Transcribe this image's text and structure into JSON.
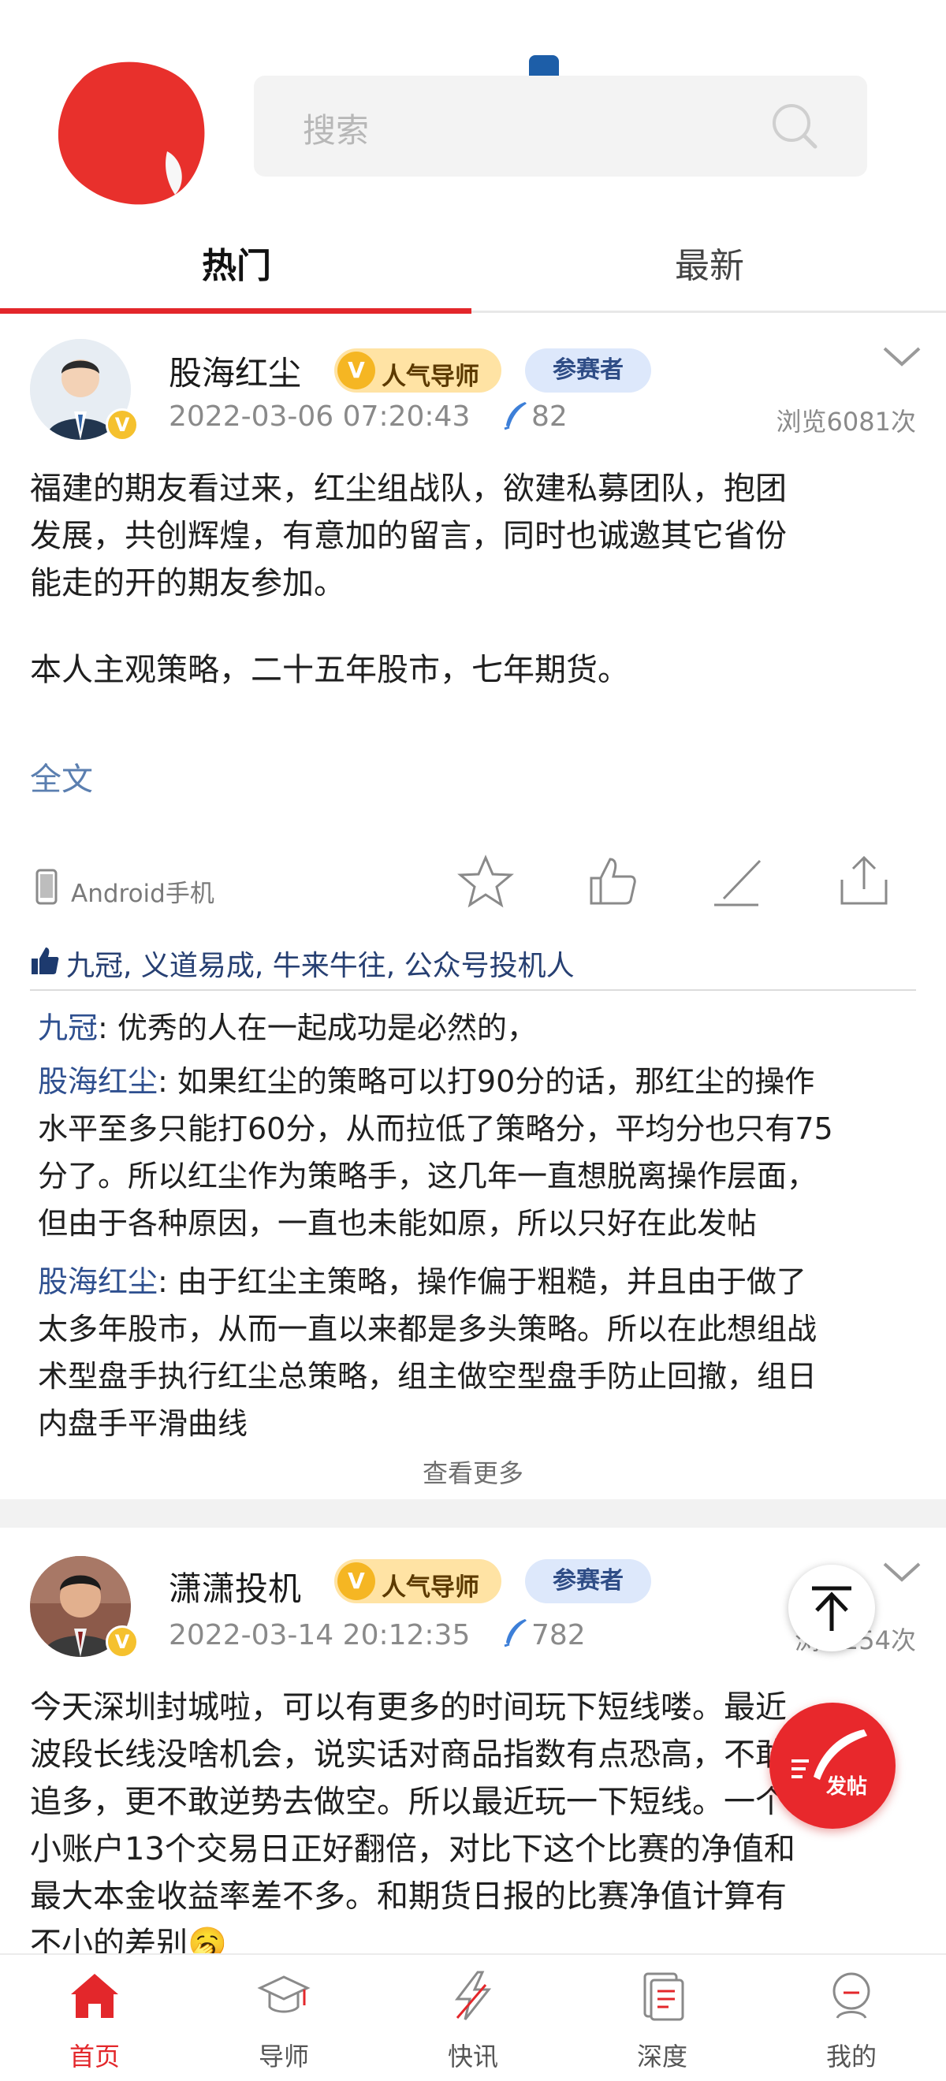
{
  "search": {
    "placeholder": "搜索"
  },
  "tabs": [
    {
      "label": "热门",
      "active": true
    },
    {
      "label": "最新",
      "active": false
    }
  ],
  "colors": {
    "accent": "#e3272b",
    "link": "#2e4f8f",
    "tag_mentor_bg": "#ffe3a4",
    "tag_player_bg": "#dde8fb"
  },
  "posts": [
    {
      "author": "股海红尘",
      "badge_letter": "V",
      "tag_mentor": "人气导师",
      "tag_player": "参赛者",
      "date": "2022-03-06 07:20:43",
      "pen_count": "82",
      "views": "浏览6081次",
      "body_lines": [
        "福建的期友看过来，红尘组战队，欲建私募团队，抱团",
        "发展，共创辉煌，有意加的留言，同时也诚邀其它省份",
        "能走的开的期友参加。",
        "本人主观策略，二十五年股市，七年期货。"
      ],
      "fulltext_link": "全文",
      "device": "Android手机",
      "likes": "九冠, 义道易成, 牛来牛往, 公众号投机人",
      "comments": [
        {
          "author": "九冠",
          "sep": ": ",
          "lines": [
            "优秀的人在一起成功是必然的，"
          ]
        },
        {
          "author": "股海红尘",
          "sep": ": ",
          "lines": [
            "如果红尘的策略可以打90分的话，那红尘的操作",
            "水平至多只能打60分，从而拉低了策略分，平均分也只有75",
            "分了。所以红尘作为策略手，这几年一直想脱离操作层面，",
            "但由于各种原因，一直也未能如原，所以只好在此发帖"
          ]
        },
        {
          "author": "股海红尘",
          "sep": ": ",
          "lines": [
            "由于红尘主策略，操作偏于粗糙，并且由于做了",
            "太多年股市，从而一直以来都是多头策略。所以在此想组战",
            "术型盘手执行红尘总策略，组主做空型盘手防止回撤，组日",
            "内盘手平滑曲线"
          ]
        }
      ],
      "see_more": "查看更多"
    },
    {
      "author": "潇潇投机",
      "badge_letter": "V",
      "tag_mentor": "人气导师",
      "tag_player": "参赛者",
      "date": "2022-03-14 20:12:35",
      "pen_count": "782",
      "views_partial_left": "浏",
      "views_partial_right": "254次",
      "body_lines": [
        "今天深圳封城啦，可以有更多的时间玩下短线喽。最近",
        "波段长线没啥机会，说实话对商品指数有点恐高，不敢",
        "追多，更不敢逆势去做空。所以最近玩一下短线。一个",
        "小账户13个交易日正好翻倍，对比下这个比赛的净值和",
        "最大本金收益率差不多。和期货日报的比赛净值计算有",
        "不小的差别🥱"
      ]
    }
  ],
  "floating": {
    "post_button_label": "发帖"
  },
  "bottom_nav": [
    {
      "label": "首页",
      "icon": "home-icon",
      "active": true
    },
    {
      "label": "导师",
      "icon": "mortarboard-icon",
      "active": false
    },
    {
      "label": "快讯",
      "icon": "lightning-icon",
      "active": false
    },
    {
      "label": "深度",
      "icon": "document-icon",
      "active": false
    },
    {
      "label": "我的",
      "icon": "profile-icon",
      "active": false
    }
  ]
}
